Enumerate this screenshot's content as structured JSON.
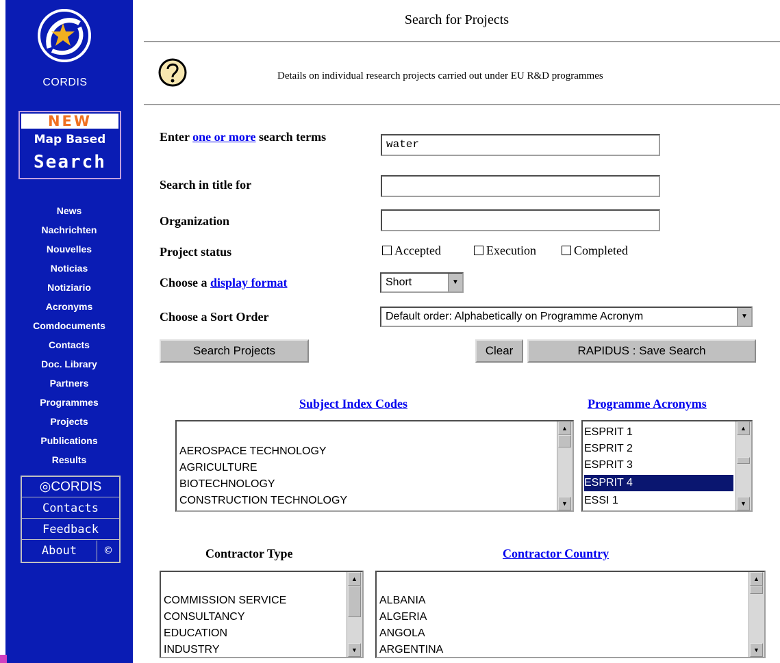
{
  "sidebar": {
    "logo_text": "CORDIS",
    "new_banner": {
      "top": "NEW",
      "middle": "Map Based",
      "bottom": "Search"
    },
    "nav_items": [
      "News",
      "Nachrichten",
      "Nouvelles",
      "Noticias",
      "Notiziario",
      "Acronyms",
      "Comdocuments",
      "Contacts",
      "Doc. Library",
      "Partners",
      "Programmes",
      "Projects",
      "Publications",
      "Results"
    ],
    "cordis_box": {
      "title": "CORDIS",
      "contacts": "Contacts",
      "feedback": "Feedback",
      "about": "About",
      "copyright": "©"
    }
  },
  "header": {
    "title": "Search for Projects",
    "description": "Details on individual research projects carried out under EU R&D programmes"
  },
  "form": {
    "search_terms": {
      "label_prefix": "Enter",
      "label_link": "one or more",
      "label_suffix": "search terms",
      "value": "water"
    },
    "title_search": {
      "label": "Search in title for",
      "value": ""
    },
    "organization": {
      "label": "Organization",
      "value": ""
    },
    "project_status": {
      "label": "Project status",
      "options": [
        "Accepted",
        "Execution",
        "Completed"
      ]
    },
    "display_format": {
      "label_prefix": "Choose a",
      "label_link": "display format",
      "value": "Short"
    },
    "sort_order": {
      "label": "Choose a Sort Order",
      "value": "Default order: Alphabetically on Programme Acronym"
    },
    "buttons": {
      "search": "Search Projects",
      "clear": "Clear",
      "save": "RAPIDUS : Save Search"
    }
  },
  "lists": {
    "subject_index": {
      "heading": "Subject Index Codes",
      "items": [
        "AEROSPACE TECHNOLOGY",
        "AGRICULTURE",
        "BIOTECHNOLOGY",
        "CONSTRUCTION TECHNOLOGY"
      ]
    },
    "programme_acronyms": {
      "heading": "Programme Acronyms",
      "items": [
        "ESPRIT 1",
        "ESPRIT 2",
        "ESPRIT 3",
        "ESPRIT 4",
        "ESSI 1"
      ],
      "selected": "ESPRIT 4"
    },
    "contractor_type": {
      "heading": "Contractor Type",
      "items": [
        "COMMISSION SERVICE",
        "CONSULTANCY",
        "EDUCATION",
        "INDUSTRY"
      ]
    },
    "contractor_country": {
      "heading": "Contractor Country",
      "items": [
        "ALBANIA",
        "ALGERIA",
        "ANGOLA",
        "ARGENTINA"
      ]
    }
  },
  "colors": {
    "sidebar_bg": "#0a1cb4",
    "link": "#0000ee",
    "selection": "#0a1670",
    "new_orange": "#f07020"
  }
}
